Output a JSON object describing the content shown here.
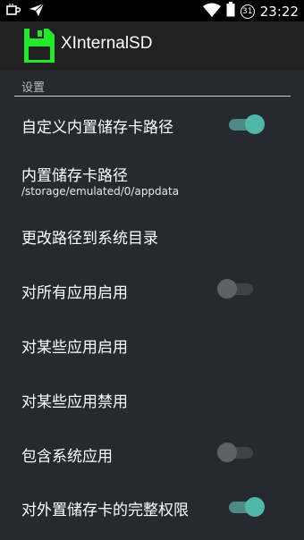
{
  "status_bar": {
    "time": "23:22",
    "notification_badge": "31",
    "icons": [
      "coffee-mug-icon",
      "send-icon",
      "wifi-icon",
      "battery-icon"
    ]
  },
  "app_bar": {
    "title": "XInternalSD",
    "icon": "floppy-disk-icon",
    "icon_color": "#23e82c"
  },
  "section": {
    "label": "设置"
  },
  "settings": [
    {
      "title": "自定义内置储存卡路径",
      "switch": true
    },
    {
      "title": "内置储存卡路径",
      "summary": "/storage/emulated/0/appdata"
    },
    {
      "title": "更改路径到系统目录"
    },
    {
      "title": "对所有应用启用",
      "switch": false
    },
    {
      "title": "对某些应用启用"
    },
    {
      "title": "对某些应用禁用"
    },
    {
      "title": "包含系统应用",
      "switch": false
    },
    {
      "title": "对外置储存卡的完整权限",
      "switch": true
    }
  ],
  "colors": {
    "background": "#262a2e",
    "switch_on": "#4fb8ab",
    "switch_off": "#5c6366"
  }
}
